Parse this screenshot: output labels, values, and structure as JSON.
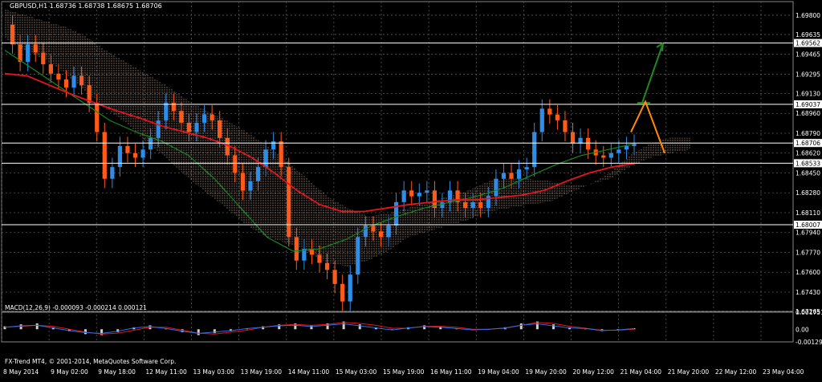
{
  "chart_data": {
    "type": "candlestick",
    "symbol_header": "GBPUSD,H1  1.68736 1.68738 1.68675 1.68706",
    "price_ticks": [
      "1.69800",
      "1.69635",
      "1.69465",
      "1.69295",
      "1.69130",
      "1.68960",
      "1.68790",
      "1.68620",
      "1.68450",
      "1.68280",
      "1.68110",
      "1.67940",
      "1.67770",
      "1.67600",
      "1.67430",
      "1.67265"
    ],
    "price_ylim": [
      1.67265,
      1.6993
    ],
    "marked_levels": [
      {
        "price": 1.69562,
        "label": "1.69562",
        "color": "#ffffff"
      },
      {
        "price": 1.69037,
        "label": "1.69037",
        "color": "#ffffff"
      },
      {
        "price": 1.68706,
        "label": "1.68706",
        "color": "#ffffff"
      },
      {
        "price": 1.68533,
        "label": "1.68533",
        "color": "#ffffff"
      },
      {
        "price": 1.68007,
        "label": "1.68007",
        "color": "#ffffff"
      }
    ],
    "time_ticks": [
      "8 May 2014",
      "9 May 02:00",
      "9 May 18:00",
      "12 May 11:00",
      "13 May 03:00",
      "13 May 19:00",
      "14 May 11:00",
      "15 May 03:00",
      "15 May 19:00",
      "16 May 11:00",
      "19 May 04:00",
      "19 May 20:00",
      "20 May 12:00",
      "21 May 04:00",
      "21 May 20:00",
      "22 May 12:00",
      "23 May 04:00"
    ],
    "close_series": [
      1.6972,
      1.6955,
      1.694,
      1.6955,
      1.6948,
      1.6938,
      1.693,
      1.6925,
      1.6918,
      1.6928,
      1.692,
      1.6905,
      1.688,
      1.684,
      1.685,
      1.6868,
      1.6862,
      1.6858,
      1.6865,
      1.6875,
      1.689,
      1.6905,
      1.6898,
      1.6888,
      1.688,
      1.6888,
      1.6895,
      1.689,
      1.6875,
      1.686,
      1.6845,
      1.683,
      1.6838,
      1.685,
      1.6865,
      1.6872,
      1.685,
      1.679,
      1.677,
      1.678,
      1.6775,
      1.6768,
      1.6762,
      1.675,
      1.6735,
      1.6758,
      1.679,
      1.68,
      1.6795,
      1.679,
      1.68,
      1.682,
      1.683,
      1.6825,
      1.6828,
      1.683,
      1.6815,
      1.682,
      1.683,
      1.682,
      1.6815,
      1.682,
      1.6815,
      1.6825,
      1.684,
      1.6845,
      1.684,
      1.6848,
      1.685,
      1.688,
      1.69,
      1.6895,
      1.689,
      1.688,
      1.687,
      1.6875,
      1.6865,
      1.686,
      1.6858,
      1.6862,
      1.6865,
      1.6868,
      1.687
    ],
    "ichimoku_cloud": {
      "upper": [
        1.6985,
        1.698,
        1.6975,
        1.697,
        1.6962,
        1.695,
        1.694,
        1.693,
        1.692,
        1.6908,
        1.6898,
        1.689,
        1.688,
        1.6868,
        1.6855,
        1.684,
        1.6825,
        1.6815,
        1.6808,
        1.681,
        1.6815,
        1.682,
        1.6825,
        1.683,
        1.6838,
        1.684,
        1.684,
        1.6838,
        1.6835,
        1.6835,
        1.6845,
        1.686,
        1.687,
        1.6875,
        1.6875
      ],
      "lower": [
        1.696,
        1.695,
        1.6942,
        1.693,
        1.6915,
        1.69,
        1.6888,
        1.6872,
        1.6858,
        1.6842,
        1.6828,
        1.6815,
        1.68,
        1.679,
        1.6785,
        1.6778,
        1.6768,
        1.6765,
        1.677,
        1.6778,
        1.679,
        1.6795,
        1.68,
        1.6805,
        1.6812,
        1.6815,
        1.6818,
        1.682,
        1.6828,
        1.6835,
        1.684,
        1.685,
        1.6858,
        1.6862,
        1.6865
      ]
    },
    "ma_red": [
      1.693,
      1.6928,
      1.692,
      1.6912,
      1.6905,
      1.6898,
      1.6892,
      1.6885,
      1.688,
      1.6875,
      1.6868,
      1.6858,
      1.6845,
      1.683,
      1.6818,
      1.6812,
      1.6812,
      1.6815,
      1.6818,
      1.682,
      1.6822,
      1.6822,
      1.6824,
      1.6826,
      1.683,
      1.6838,
      1.6845,
      1.685,
      1.6853
    ],
    "ma_green": [
      1.695,
      1.6935,
      1.692,
      1.6905,
      1.689,
      1.688,
      1.6872,
      1.686,
      1.684,
      1.6815,
      1.679,
      1.6778,
      1.678,
      1.6788,
      1.68,
      1.6808,
      1.6815,
      1.682,
      1.6825,
      1.6832,
      1.6842,
      1.6852,
      1.686,
      1.6865,
      1.687
    ],
    "projection": {
      "green_arrow_from": 1.6905,
      "green_arrow_to": 1.6956,
      "orange_peak": 1.6906,
      "orange_from": 1.688,
      "orange_to": 1.6862
    },
    "macd": {
      "label": "MACD(12,26,9) -0.000093 -0.000214 0.000121",
      "ticks": [
        "0.001751",
        "0.00",
        "-0.001296"
      ],
      "ylim": [
        -0.001296,
        0.001751
      ],
      "histogram": [
        0.0003,
        0.0005,
        0.0006,
        0.0002,
        -0.0002,
        -0.0005,
        -0.0006,
        -0.0003,
        0.0002,
        0.0004,
        0.0001,
        -0.0003,
        -0.0006,
        -0.0004,
        -0.0002,
        0.0001,
        0.0003,
        0.0005,
        0.0006,
        0.0004,
        0.0006,
        0.0008,
        0.0005,
        0.0002,
        -0.0001,
        0.0002,
        0.0004,
        0.0003,
        0.0001,
        -0.0001,
        0.0,
        0.0002,
        0.0006,
        0.0008,
        0.0005,
        0.0002,
        0.0001,
        -0.0002,
        -0.0001,
        0.0001
      ],
      "signal": [
        0.0002,
        0.0003,
        0.0004,
        0.0003,
        0.0,
        -0.0003,
        -0.0005,
        -0.0004,
        -0.0001,
        0.0002,
        0.0002,
        -0.0001,
        -0.0004,
        -0.0005,
        -0.0003,
        -0.0001,
        0.0002,
        0.0004,
        0.0005,
        0.0004,
        0.0005,
        0.0007,
        0.0006,
        0.0004,
        0.0001,
        0.0001,
        0.0003,
        0.0003,
        0.0002,
        0.0,
        0.0,
        0.0001,
        0.0004,
        0.0007,
        0.0006,
        0.0003,
        0.0001,
        -0.0001,
        -0.0001,
        0.0
      ]
    },
    "colors": {
      "bull": "#2e8de8",
      "bear": "#ff5a1a",
      "grid": "#5a5a5a",
      "ma_red": "#e8141c",
      "ma_green": "#138a1c",
      "cloud": "#f3c3a5",
      "arrow_green": "#1e8a1e",
      "arrow_orange": "#ff8c00",
      "macd_hist": "#cfcfcf",
      "macd_signal": "#e81414",
      "macd_line": "#2e6ee8"
    }
  },
  "footer": {
    "copyright": "FX-Trend MT4, © 2001-2014, MetaQuotes Software Corp."
  }
}
